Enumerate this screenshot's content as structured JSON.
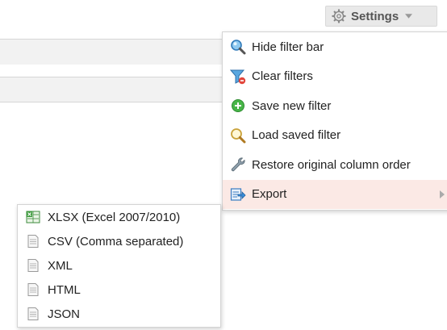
{
  "settings": {
    "label": "Settings",
    "icon": "gear-icon",
    "color": "#555555"
  },
  "menu": {
    "items": [
      {
        "label": "Hide filter bar",
        "icon": "magnifier-blue-icon"
      },
      {
        "label": "Clear filters",
        "icon": "funnel-clear-icon"
      },
      {
        "label": "Save new filter",
        "icon": "add-green-icon"
      },
      {
        "label": "Load saved filter",
        "icon": "magnifier-icon"
      },
      {
        "label": "Restore original column order",
        "icon": "wrench-icon"
      },
      {
        "label": "Export",
        "icon": "export-icon",
        "active": true,
        "active_color": "#fbe9e5"
      }
    ]
  },
  "export_submenu": {
    "items": [
      {
        "label": "XLSX (Excel 2007/2010)",
        "icon": "excel-icon"
      },
      {
        "label": "CSV (Comma separated)",
        "icon": "document-icon"
      },
      {
        "label": "XML",
        "icon": "document-icon"
      },
      {
        "label": "HTML",
        "icon": "document-icon"
      },
      {
        "label": "JSON",
        "icon": "document-icon"
      }
    ]
  }
}
